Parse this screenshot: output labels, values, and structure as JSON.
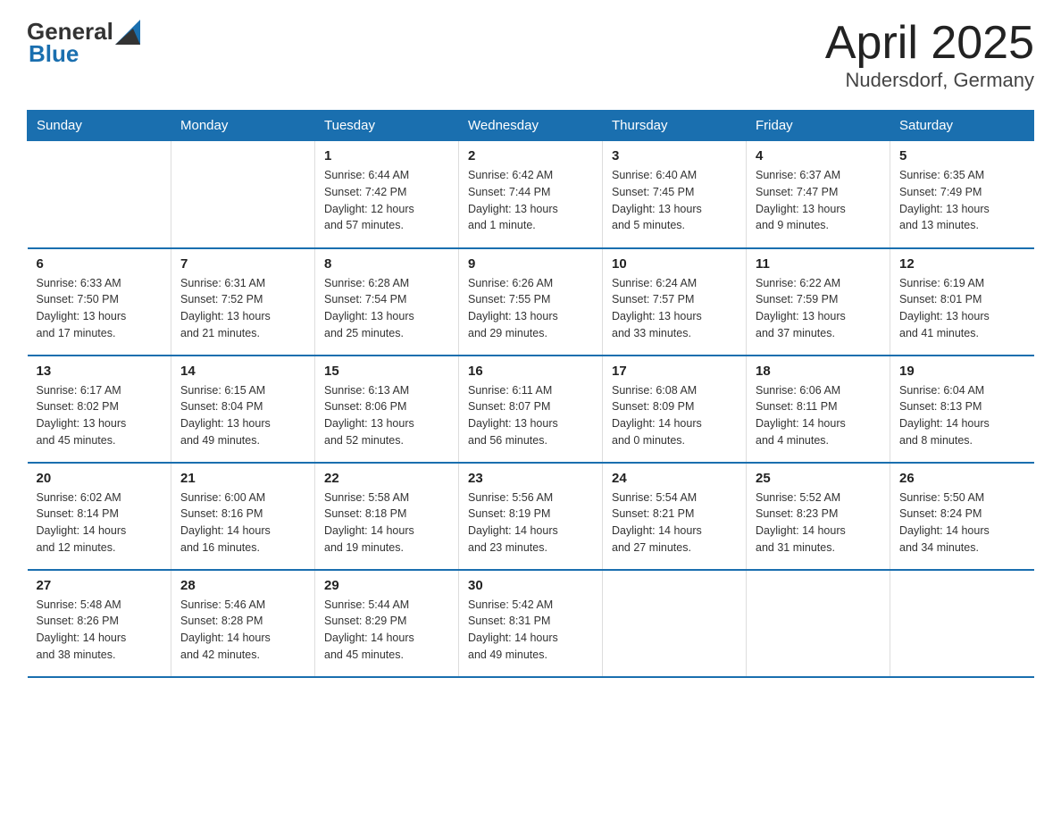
{
  "header": {
    "logo_general": "General",
    "logo_blue": "Blue",
    "title": "April 2025",
    "subtitle": "Nudersdorf, Germany"
  },
  "days_of_week": [
    "Sunday",
    "Monday",
    "Tuesday",
    "Wednesday",
    "Thursday",
    "Friday",
    "Saturday"
  ],
  "weeks": [
    [
      {
        "day": "",
        "info": ""
      },
      {
        "day": "",
        "info": ""
      },
      {
        "day": "1",
        "info": "Sunrise: 6:44 AM\nSunset: 7:42 PM\nDaylight: 12 hours\nand 57 minutes."
      },
      {
        "day": "2",
        "info": "Sunrise: 6:42 AM\nSunset: 7:44 PM\nDaylight: 13 hours\nand 1 minute."
      },
      {
        "day": "3",
        "info": "Sunrise: 6:40 AM\nSunset: 7:45 PM\nDaylight: 13 hours\nand 5 minutes."
      },
      {
        "day": "4",
        "info": "Sunrise: 6:37 AM\nSunset: 7:47 PM\nDaylight: 13 hours\nand 9 minutes."
      },
      {
        "day": "5",
        "info": "Sunrise: 6:35 AM\nSunset: 7:49 PM\nDaylight: 13 hours\nand 13 minutes."
      }
    ],
    [
      {
        "day": "6",
        "info": "Sunrise: 6:33 AM\nSunset: 7:50 PM\nDaylight: 13 hours\nand 17 minutes."
      },
      {
        "day": "7",
        "info": "Sunrise: 6:31 AM\nSunset: 7:52 PM\nDaylight: 13 hours\nand 21 minutes."
      },
      {
        "day": "8",
        "info": "Sunrise: 6:28 AM\nSunset: 7:54 PM\nDaylight: 13 hours\nand 25 minutes."
      },
      {
        "day": "9",
        "info": "Sunrise: 6:26 AM\nSunset: 7:55 PM\nDaylight: 13 hours\nand 29 minutes."
      },
      {
        "day": "10",
        "info": "Sunrise: 6:24 AM\nSunset: 7:57 PM\nDaylight: 13 hours\nand 33 minutes."
      },
      {
        "day": "11",
        "info": "Sunrise: 6:22 AM\nSunset: 7:59 PM\nDaylight: 13 hours\nand 37 minutes."
      },
      {
        "day": "12",
        "info": "Sunrise: 6:19 AM\nSunset: 8:01 PM\nDaylight: 13 hours\nand 41 minutes."
      }
    ],
    [
      {
        "day": "13",
        "info": "Sunrise: 6:17 AM\nSunset: 8:02 PM\nDaylight: 13 hours\nand 45 minutes."
      },
      {
        "day": "14",
        "info": "Sunrise: 6:15 AM\nSunset: 8:04 PM\nDaylight: 13 hours\nand 49 minutes."
      },
      {
        "day": "15",
        "info": "Sunrise: 6:13 AM\nSunset: 8:06 PM\nDaylight: 13 hours\nand 52 minutes."
      },
      {
        "day": "16",
        "info": "Sunrise: 6:11 AM\nSunset: 8:07 PM\nDaylight: 13 hours\nand 56 minutes."
      },
      {
        "day": "17",
        "info": "Sunrise: 6:08 AM\nSunset: 8:09 PM\nDaylight: 14 hours\nand 0 minutes."
      },
      {
        "day": "18",
        "info": "Sunrise: 6:06 AM\nSunset: 8:11 PM\nDaylight: 14 hours\nand 4 minutes."
      },
      {
        "day": "19",
        "info": "Sunrise: 6:04 AM\nSunset: 8:13 PM\nDaylight: 14 hours\nand 8 minutes."
      }
    ],
    [
      {
        "day": "20",
        "info": "Sunrise: 6:02 AM\nSunset: 8:14 PM\nDaylight: 14 hours\nand 12 minutes."
      },
      {
        "day": "21",
        "info": "Sunrise: 6:00 AM\nSunset: 8:16 PM\nDaylight: 14 hours\nand 16 minutes."
      },
      {
        "day": "22",
        "info": "Sunrise: 5:58 AM\nSunset: 8:18 PM\nDaylight: 14 hours\nand 19 minutes."
      },
      {
        "day": "23",
        "info": "Sunrise: 5:56 AM\nSunset: 8:19 PM\nDaylight: 14 hours\nand 23 minutes."
      },
      {
        "day": "24",
        "info": "Sunrise: 5:54 AM\nSunset: 8:21 PM\nDaylight: 14 hours\nand 27 minutes."
      },
      {
        "day": "25",
        "info": "Sunrise: 5:52 AM\nSunset: 8:23 PM\nDaylight: 14 hours\nand 31 minutes."
      },
      {
        "day": "26",
        "info": "Sunrise: 5:50 AM\nSunset: 8:24 PM\nDaylight: 14 hours\nand 34 minutes."
      }
    ],
    [
      {
        "day": "27",
        "info": "Sunrise: 5:48 AM\nSunset: 8:26 PM\nDaylight: 14 hours\nand 38 minutes."
      },
      {
        "day": "28",
        "info": "Sunrise: 5:46 AM\nSunset: 8:28 PM\nDaylight: 14 hours\nand 42 minutes."
      },
      {
        "day": "29",
        "info": "Sunrise: 5:44 AM\nSunset: 8:29 PM\nDaylight: 14 hours\nand 45 minutes."
      },
      {
        "day": "30",
        "info": "Sunrise: 5:42 AM\nSunset: 8:31 PM\nDaylight: 14 hours\nand 49 minutes."
      },
      {
        "day": "",
        "info": ""
      },
      {
        "day": "",
        "info": ""
      },
      {
        "day": "",
        "info": ""
      }
    ]
  ]
}
